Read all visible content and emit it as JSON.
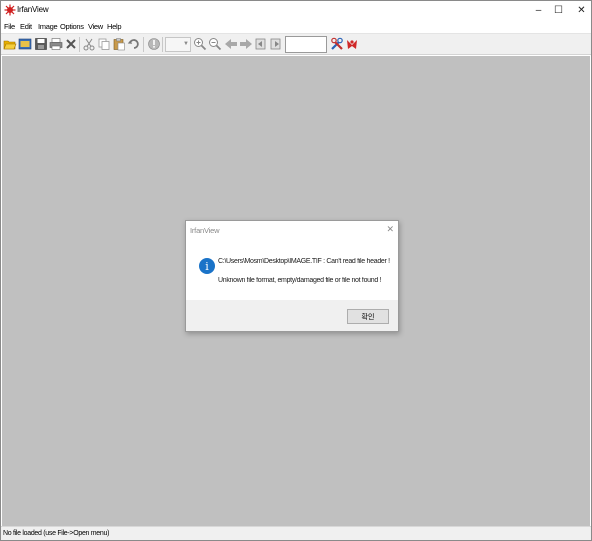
{
  "window": {
    "title": "IrfanView",
    "controls": {
      "minimize": "–",
      "maximize": "☐",
      "close": "✕"
    }
  },
  "menu": [
    "File",
    "Edit",
    "Image",
    "Options",
    "View",
    "Help"
  ],
  "toolbar": {
    "icons": [
      "open-folder-icon",
      "thumbnails-icon",
      "save-icon",
      "print-icon",
      "delete-icon",
      "cut-icon",
      "copy-icon",
      "paste-icon",
      "undo-icon",
      "info-icon",
      "zoom-in-icon",
      "zoom-out-icon",
      "previous-icon",
      "next-icon",
      "previous-page-icon",
      "next-page-icon",
      "settings-icon",
      "exit-icon"
    ],
    "zoom_value": "",
    "page_value": ""
  },
  "dialog": {
    "title": "IrfanView",
    "close": "✕",
    "icon": "i",
    "message_line1": "C:\\Users\\Mosm\\Desktop\\IMAGE.TIF : Can't read file header !",
    "message_line2": "Unknown file format, empty/damaged file or file not found !",
    "ok_label": "확인"
  },
  "statusbar": {
    "text": "No file loaded (use File->Open menu)"
  },
  "colors": {
    "canvas": "#c0c0c0",
    "info_icon": "#1a73c8",
    "toolbar_bg": "#f0f0f0"
  }
}
